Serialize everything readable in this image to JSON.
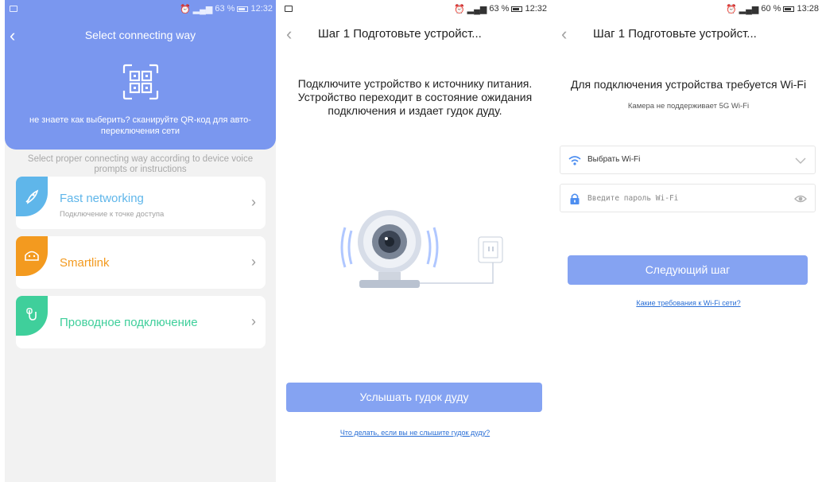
{
  "screen1": {
    "status": {
      "time": "12:32",
      "battery": "63 %"
    },
    "title": "Select connecting way",
    "qr_hint": "не знаете как выберить? сканируйте QR-код для авто-переключения сети",
    "subtitle": "Select proper connecting way according to device voice prompts or instructions",
    "options": [
      {
        "name": "Fast networking",
        "desc": "Подключение к точке доступа",
        "color": "#5fb6ea",
        "icon": "rocket-icon"
      },
      {
        "name": "Smartlink",
        "desc": "",
        "color": "#f39a1f",
        "icon": "android-icon"
      },
      {
        "name": "Проводное подключение",
        "desc": "",
        "color": "#3fcf9b",
        "icon": "cable-icon"
      }
    ],
    "colors": {
      "header": "#7a97ef",
      "background": "#f2f2f2"
    }
  },
  "screen2": {
    "status": {
      "time": "12:32",
      "battery": "63 %"
    },
    "title": "Шаг 1 Подготовьте устройст...",
    "instruction": "Подключите устройство к источнику питания.\nУстройство переходит в состояние ожидания подключения и издает гудок дуду.",
    "button": "Услышать гудок дуду",
    "link": "Что делать, если вы не слышите гудок дуду?"
  },
  "screen3": {
    "status": {
      "time": "13:28",
      "battery": "60 %"
    },
    "title": "Шаг 1 Подготовьте устройст...",
    "requirement": "Для подключения устройства требуется Wi-Fi",
    "note": "Камера не поддерживает 5G Wi-Fi",
    "wifi_select": "Выбрать Wi-Fi",
    "password_placeholder": "Введите пароль Wi-Fi",
    "button": "Следующий шаг",
    "link": "Какие требования к Wi-Fi сети?",
    "colors": {
      "button": "#85a3f2",
      "link": "#2a6fd6"
    }
  }
}
